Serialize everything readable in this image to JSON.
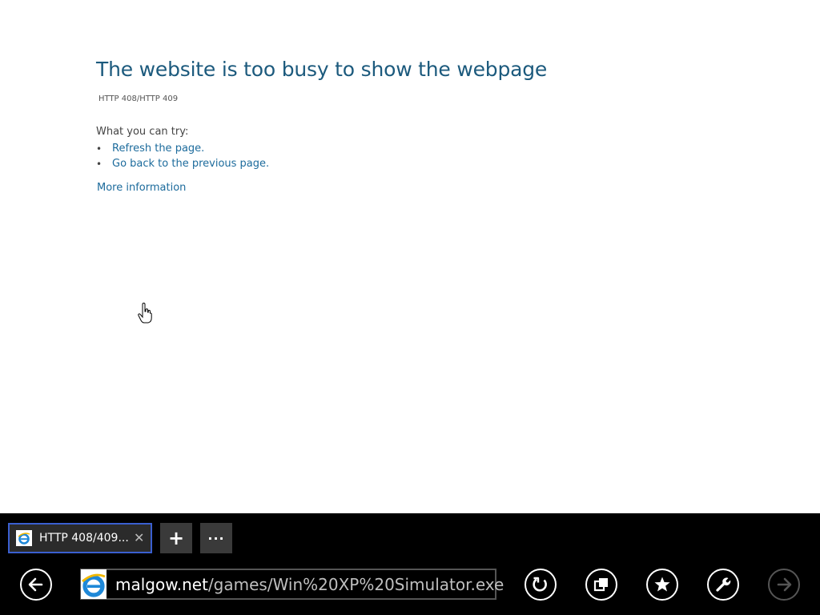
{
  "error": {
    "title": "The website is too busy to show the webpage",
    "code": "HTTP 408/HTTP 409",
    "try_heading": "What you can try:",
    "suggestions": [
      {
        "bullet": "•",
        "text": "Refresh the page."
      },
      {
        "bullet": "•",
        "text": "Go back to the previous page."
      }
    ],
    "more_info": "More information"
  },
  "tab": {
    "title": "HTTP 408/409...",
    "close_glyph": "✕",
    "favicon": "ie-logo-icon"
  },
  "tab_controls": {
    "new_tab_glyph": "+",
    "more_glyph": "···"
  },
  "address_bar": {
    "domain": "malgow.net",
    "path": "/games/Win%20XP%20Simulator.exe",
    "favicon": "ie-logo-icon"
  },
  "nav_icons": {
    "back": "back-arrow-icon",
    "refresh": "refresh-icon",
    "pin": "pin-icon",
    "favorites": "star-icon",
    "tools": "wrench-icon",
    "forward": "forward-arrow-icon"
  },
  "colors": {
    "title": "#1c5a7d",
    "link": "#1c6b9c",
    "tab_border": "#3a5fd0",
    "appbar": "#000000"
  }
}
